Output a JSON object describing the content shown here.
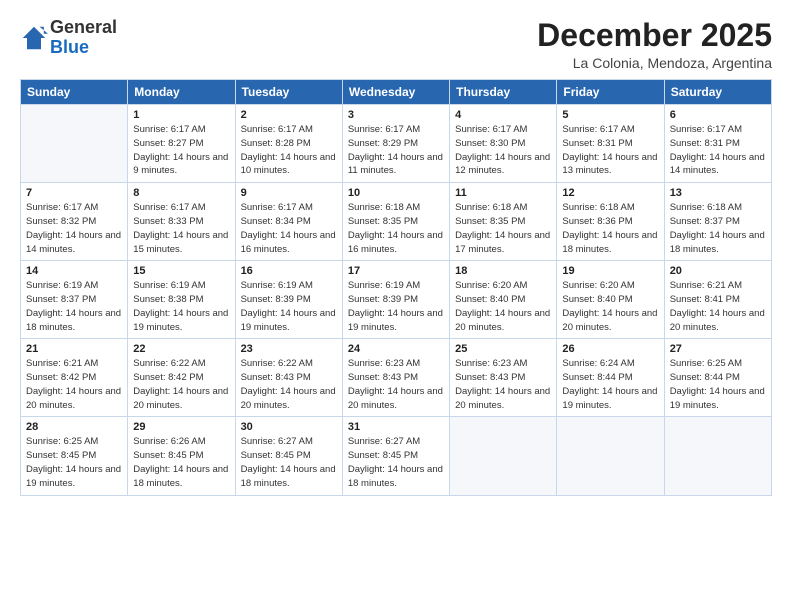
{
  "logo": {
    "general": "General",
    "blue": "Blue"
  },
  "title": "December 2025",
  "subtitle": "La Colonia, Mendoza, Argentina",
  "days": [
    "Sunday",
    "Monday",
    "Tuesday",
    "Wednesday",
    "Thursday",
    "Friday",
    "Saturday"
  ],
  "weeks": [
    [
      {
        "date": "",
        "sunrise": "",
        "sunset": "",
        "daylight": "",
        "empty": true
      },
      {
        "date": "1",
        "sunrise": "Sunrise: 6:17 AM",
        "sunset": "Sunset: 8:27 PM",
        "daylight": "Daylight: 14 hours and 9 minutes."
      },
      {
        "date": "2",
        "sunrise": "Sunrise: 6:17 AM",
        "sunset": "Sunset: 8:28 PM",
        "daylight": "Daylight: 14 hours and 10 minutes."
      },
      {
        "date": "3",
        "sunrise": "Sunrise: 6:17 AM",
        "sunset": "Sunset: 8:29 PM",
        "daylight": "Daylight: 14 hours and 11 minutes."
      },
      {
        "date": "4",
        "sunrise": "Sunrise: 6:17 AM",
        "sunset": "Sunset: 8:30 PM",
        "daylight": "Daylight: 14 hours and 12 minutes."
      },
      {
        "date": "5",
        "sunrise": "Sunrise: 6:17 AM",
        "sunset": "Sunset: 8:31 PM",
        "daylight": "Daylight: 14 hours and 13 minutes."
      },
      {
        "date": "6",
        "sunrise": "Sunrise: 6:17 AM",
        "sunset": "Sunset: 8:31 PM",
        "daylight": "Daylight: 14 hours and 14 minutes."
      }
    ],
    [
      {
        "date": "7",
        "sunrise": "Sunrise: 6:17 AM",
        "sunset": "Sunset: 8:32 PM",
        "daylight": "Daylight: 14 hours and 14 minutes."
      },
      {
        "date": "8",
        "sunrise": "Sunrise: 6:17 AM",
        "sunset": "Sunset: 8:33 PM",
        "daylight": "Daylight: 14 hours and 15 minutes."
      },
      {
        "date": "9",
        "sunrise": "Sunrise: 6:17 AM",
        "sunset": "Sunset: 8:34 PM",
        "daylight": "Daylight: 14 hours and 16 minutes."
      },
      {
        "date": "10",
        "sunrise": "Sunrise: 6:18 AM",
        "sunset": "Sunset: 8:35 PM",
        "daylight": "Daylight: 14 hours and 16 minutes."
      },
      {
        "date": "11",
        "sunrise": "Sunrise: 6:18 AM",
        "sunset": "Sunset: 8:35 PM",
        "daylight": "Daylight: 14 hours and 17 minutes."
      },
      {
        "date": "12",
        "sunrise": "Sunrise: 6:18 AM",
        "sunset": "Sunset: 8:36 PM",
        "daylight": "Daylight: 14 hours and 18 minutes."
      },
      {
        "date": "13",
        "sunrise": "Sunrise: 6:18 AM",
        "sunset": "Sunset: 8:37 PM",
        "daylight": "Daylight: 14 hours and 18 minutes."
      }
    ],
    [
      {
        "date": "14",
        "sunrise": "Sunrise: 6:19 AM",
        "sunset": "Sunset: 8:37 PM",
        "daylight": "Daylight: 14 hours and 18 minutes."
      },
      {
        "date": "15",
        "sunrise": "Sunrise: 6:19 AM",
        "sunset": "Sunset: 8:38 PM",
        "daylight": "Daylight: 14 hours and 19 minutes."
      },
      {
        "date": "16",
        "sunrise": "Sunrise: 6:19 AM",
        "sunset": "Sunset: 8:39 PM",
        "daylight": "Daylight: 14 hours and 19 minutes."
      },
      {
        "date": "17",
        "sunrise": "Sunrise: 6:19 AM",
        "sunset": "Sunset: 8:39 PM",
        "daylight": "Daylight: 14 hours and 19 minutes."
      },
      {
        "date": "18",
        "sunrise": "Sunrise: 6:20 AM",
        "sunset": "Sunset: 8:40 PM",
        "daylight": "Daylight: 14 hours and 20 minutes."
      },
      {
        "date": "19",
        "sunrise": "Sunrise: 6:20 AM",
        "sunset": "Sunset: 8:40 PM",
        "daylight": "Daylight: 14 hours and 20 minutes."
      },
      {
        "date": "20",
        "sunrise": "Sunrise: 6:21 AM",
        "sunset": "Sunset: 8:41 PM",
        "daylight": "Daylight: 14 hours and 20 minutes."
      }
    ],
    [
      {
        "date": "21",
        "sunrise": "Sunrise: 6:21 AM",
        "sunset": "Sunset: 8:42 PM",
        "daylight": "Daylight: 14 hours and 20 minutes."
      },
      {
        "date": "22",
        "sunrise": "Sunrise: 6:22 AM",
        "sunset": "Sunset: 8:42 PM",
        "daylight": "Daylight: 14 hours and 20 minutes."
      },
      {
        "date": "23",
        "sunrise": "Sunrise: 6:22 AM",
        "sunset": "Sunset: 8:43 PM",
        "daylight": "Daylight: 14 hours and 20 minutes."
      },
      {
        "date": "24",
        "sunrise": "Sunrise: 6:23 AM",
        "sunset": "Sunset: 8:43 PM",
        "daylight": "Daylight: 14 hours and 20 minutes."
      },
      {
        "date": "25",
        "sunrise": "Sunrise: 6:23 AM",
        "sunset": "Sunset: 8:43 PM",
        "daylight": "Daylight: 14 hours and 20 minutes."
      },
      {
        "date": "26",
        "sunrise": "Sunrise: 6:24 AM",
        "sunset": "Sunset: 8:44 PM",
        "daylight": "Daylight: 14 hours and 19 minutes."
      },
      {
        "date": "27",
        "sunrise": "Sunrise: 6:25 AM",
        "sunset": "Sunset: 8:44 PM",
        "daylight": "Daylight: 14 hours and 19 minutes."
      }
    ],
    [
      {
        "date": "28",
        "sunrise": "Sunrise: 6:25 AM",
        "sunset": "Sunset: 8:45 PM",
        "daylight": "Daylight: 14 hours and 19 minutes."
      },
      {
        "date": "29",
        "sunrise": "Sunrise: 6:26 AM",
        "sunset": "Sunset: 8:45 PM",
        "daylight": "Daylight: 14 hours and 18 minutes."
      },
      {
        "date": "30",
        "sunrise": "Sunrise: 6:27 AM",
        "sunset": "Sunset: 8:45 PM",
        "daylight": "Daylight: 14 hours and 18 minutes."
      },
      {
        "date": "31",
        "sunrise": "Sunrise: 6:27 AM",
        "sunset": "Sunset: 8:45 PM",
        "daylight": "Daylight: 14 hours and 18 minutes."
      },
      {
        "date": "",
        "sunrise": "",
        "sunset": "",
        "daylight": "",
        "empty": true
      },
      {
        "date": "",
        "sunrise": "",
        "sunset": "",
        "daylight": "",
        "empty": true
      },
      {
        "date": "",
        "sunrise": "",
        "sunset": "",
        "daylight": "",
        "empty": true
      }
    ]
  ]
}
